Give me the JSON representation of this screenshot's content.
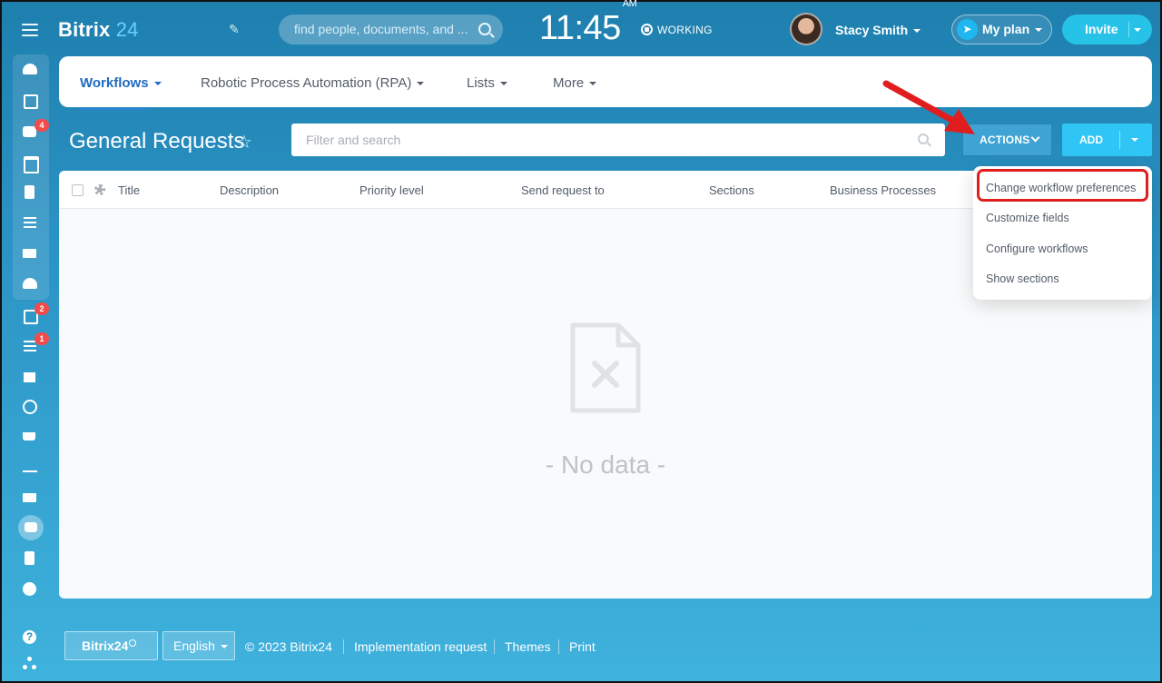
{
  "header": {
    "logo_text": "Bitrix",
    "logo_num": "24",
    "search_placeholder": "find people, documents, and ...",
    "time": "11:45",
    "time_suffix": "AM",
    "work_status": "WORKING",
    "user_name": "Stacy Smith",
    "plan_label": "My plan",
    "invite_label": "Invite"
  },
  "sidebar": {
    "badges": [
      "4",
      "2",
      "1"
    ]
  },
  "nav": {
    "tabs": [
      "Workflows",
      "Robotic Process Automation (RPA)",
      "Lists",
      "More"
    ]
  },
  "page": {
    "title": "General Requests",
    "filter_placeholder": "Filter and search",
    "actions_label": "ACTIONS",
    "add_label": "ADD"
  },
  "grid": {
    "columns": [
      "Title",
      "Description",
      "Priority level",
      "Send request to",
      "Sections",
      "Business Processes"
    ],
    "empty_text": "- No data -"
  },
  "actions_menu": {
    "items": [
      "Change workflow preferences",
      "Customize fields",
      "Configure workflows",
      "Show sections"
    ],
    "highlighted_color": "#e01e1e"
  },
  "footer": {
    "brand_button": "Bitrix24",
    "language": "English",
    "copyright": "© 2023 Bitrix24",
    "links": [
      "Implementation request",
      "Themes",
      "Print"
    ]
  },
  "colors": {
    "accent": "#2fc6f6",
    "active_tab": "#1f6bc1",
    "badge": "#f24b4b",
    "annotation": "#e01e1e"
  }
}
